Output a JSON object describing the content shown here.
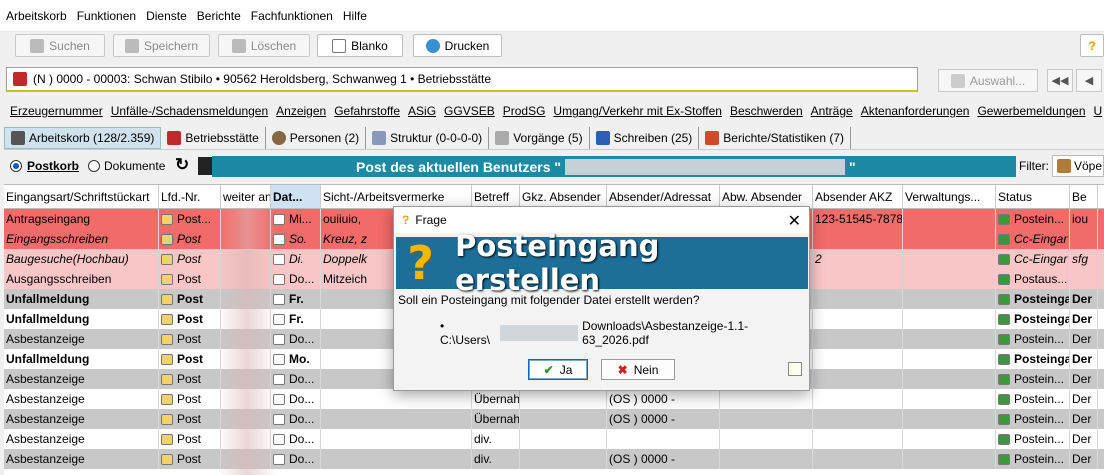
{
  "menu": [
    "Arbeitskorb",
    "Funktionen",
    "Dienste",
    "Berichte",
    "Fachfunktionen",
    "Hilfe"
  ],
  "toolbar": {
    "suchen": "Suchen",
    "speichern": "Speichern",
    "loeschen": "Löschen",
    "blanko": "Blanko",
    "drucken": "Drucken"
  },
  "address": {
    "text": "(N )   0000 - 00003: Schwan Stibilo • 90562 Heroldsberg, Schwanweg 1 • Betriebsstätte",
    "auswahl": "Auswahl..."
  },
  "links": [
    "Erzeugernummer",
    "Unfälle-/Schadensmeldungen",
    "Anzeigen",
    "Gefahrstoffe",
    "ASiG",
    "GGVSEB",
    "ProdSG",
    "Umgang/Verkehr mit Ex-Stoffen",
    "Beschwerden",
    "Anträge",
    "Aktenanforderungen",
    "Gewerbemeldungen",
    "U"
  ],
  "tabs": [
    {
      "label": "Arbeitskorb (128/2.359)"
    },
    {
      "label": "Betriebsstätte"
    },
    {
      "label": "Personen (2)"
    },
    {
      "label": "Struktur (0-0-0-0)"
    },
    {
      "label": "Vorgänge (5)"
    },
    {
      "label": "Schreiben (25)"
    },
    {
      "label": "Berichte/Statistiken (7)"
    }
  ],
  "post": {
    "postkorb": "Postkorb",
    "dokumente": "Dokumente",
    "banner_left": "Post des aktuellen Benutzers \"",
    "banner_right": "\"",
    "filter": "Filter:",
    "voep": "Vöpe"
  },
  "columns": [
    "Eingangsart/Schriftstückart",
    "Lfd.-Nr.",
    "weiter an",
    "Dat...",
    "Sicht-/Arbeitsvermerke",
    "Betreff",
    "Gkz. Absender",
    "Absender/Adressat",
    "Abw. Absender",
    "Absender AKZ",
    "Verwaltungs...",
    "Status",
    "Be"
  ],
  "rows": [
    {
      "cls": "r-red",
      "c": [
        "Antragseingang",
        "Post...",
        "",
        "Mi...",
        "ouiiuio,",
        "",
        "",
        "",
        "",
        "123-51545-7878",
        "",
        "Postein...",
        "iou"
      ]
    },
    {
      "cls": "r-red r-ital",
      "c": [
        "Eingangsschreiben",
        "Post",
        "",
        "So.",
        "Kreuz, z",
        "",
        "",
        "",
        "",
        "",
        "",
        "Cc-Eingar",
        ""
      ]
    },
    {
      "cls": "r-pink r-ital",
      "c": [
        "Baugesuche(Hochbau)",
        "Post",
        "",
        "Di.",
        "Doppelk",
        "",
        "",
        "",
        "",
        "2",
        "",
        "Cc-Eingar",
        "sfg"
      ]
    },
    {
      "cls": "r-pink",
      "c": [
        "Ausgangsschreiben",
        "Post",
        "",
        "Do...",
        "Mitzeich",
        "",
        "",
        "",
        "",
        "",
        "",
        "Postaus...",
        ""
      ]
    },
    {
      "cls": "r-gray r-bold",
      "c": [
        "Unfallmeldung",
        "Post",
        "",
        "Fr.",
        "",
        "",
        "",
        "",
        "",
        "",
        "",
        "Posteinga",
        "Der"
      ]
    },
    {
      "cls": "r-white r-bold",
      "c": [
        "Unfallmeldung",
        "Post",
        "",
        "Fr.",
        "",
        "",
        "",
        "",
        "",
        "",
        "",
        "Posteinga",
        "Der"
      ]
    },
    {
      "cls": "r-gray",
      "c": [
        "Asbestanzeige",
        "Post",
        "",
        "Do...",
        "",
        "",
        "",
        "",
        "",
        "",
        "",
        "Postein...",
        "Der"
      ]
    },
    {
      "cls": "r-white r-bold",
      "c": [
        "Unfallmeldung",
        "Post",
        "",
        "Mo.",
        "",
        "",
        "",
        "",
        "",
        "",
        "",
        "Posteinga",
        "Der"
      ]
    },
    {
      "cls": "r-gray",
      "c": [
        "Asbestanzeige",
        "Post",
        "",
        "Do...",
        "",
        "",
        "",
        "",
        "",
        "",
        "",
        "Postein...",
        "Der"
      ]
    },
    {
      "cls": "r-white",
      "c": [
        "Asbestanzeige",
        "Post",
        "",
        "Do...",
        "",
        "Übernahi",
        "",
        "(OS ) 0000 -",
        "",
        "",
        "",
        "Postein...",
        "Der"
      ]
    },
    {
      "cls": "r-gray",
      "c": [
        "Asbestanzeige",
        "Post",
        "",
        "Do...",
        "",
        "Übernahi",
        "",
        "(OS ) 0000 -",
        "",
        "",
        "",
        "Postein...",
        "Der"
      ]
    },
    {
      "cls": "r-white",
      "c": [
        "Asbestanzeige",
        "Post",
        "",
        "Do...",
        "",
        "div.",
        "",
        "",
        "",
        "",
        "",
        "Postein...",
        "Der"
      ]
    },
    {
      "cls": "r-gray",
      "c": [
        "Asbestanzeige",
        "Post",
        "",
        "Do...",
        "",
        "div.",
        "",
        "(OS ) 0000 -",
        "",
        "",
        "",
        "Postein...",
        "Der"
      ]
    }
  ],
  "dialog": {
    "title": "Frage",
    "heading": "Posteingang erstellen",
    "question": "Soll ein Posteingang mit folgender Datei  erstellt werden?",
    "file_prefix": "• C:\\Users\\",
    "file_suffix": "Downloads\\Asbestanzeige-1.1-63_2026.pdf",
    "yes": "Ja",
    "no": "Nein"
  },
  "colors": {
    "banner": "#1d8aa3",
    "dialog_banner": "#1d6f9a",
    "row_red": "#f26a6a",
    "row_pink": "#f8c6c6"
  }
}
